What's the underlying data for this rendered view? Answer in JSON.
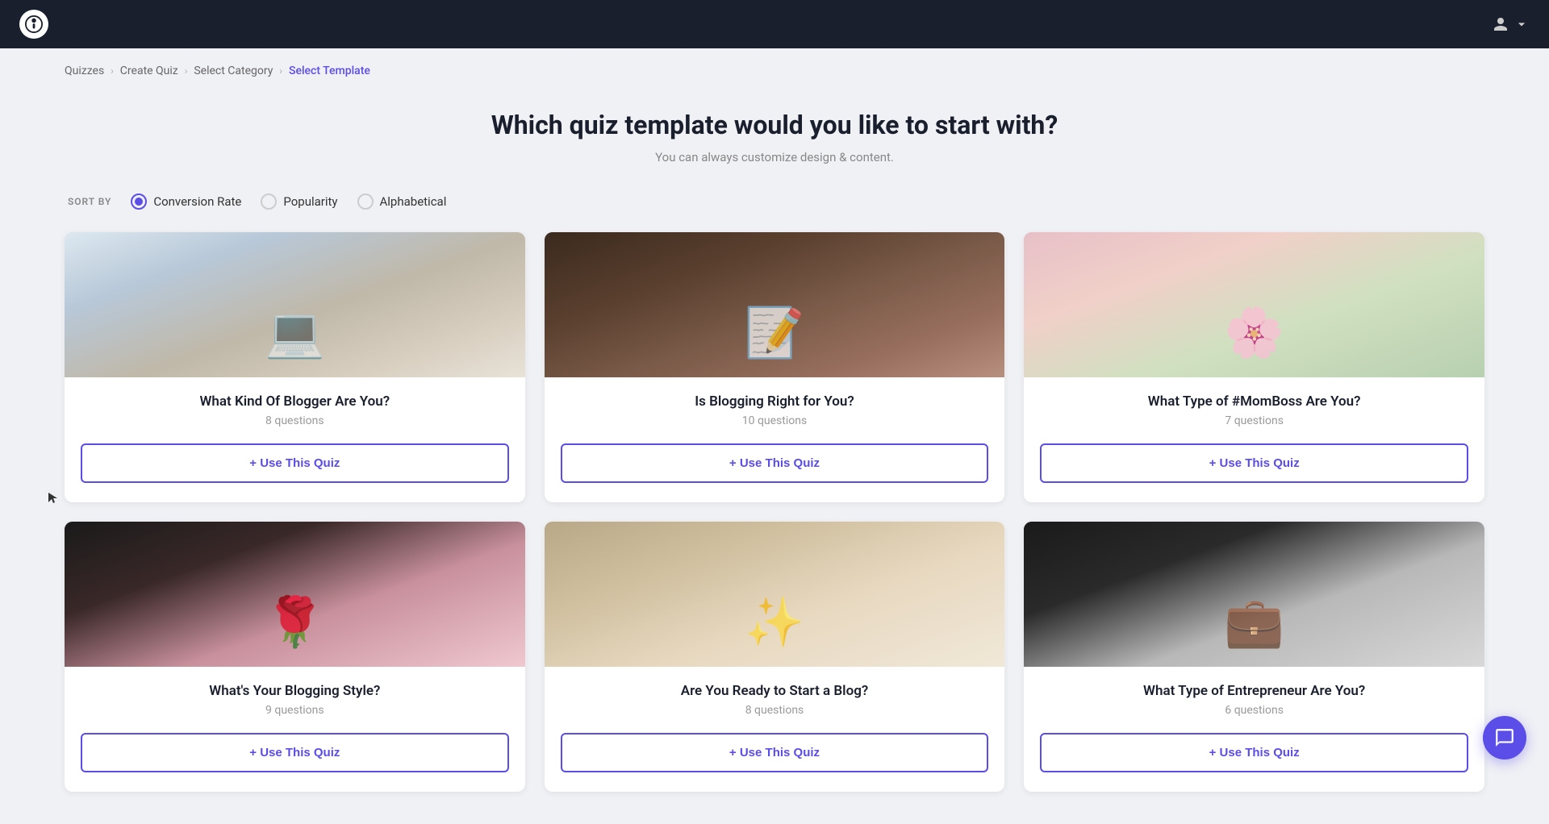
{
  "header": {
    "logo_text": "i",
    "user_icon": "person"
  },
  "breadcrumb": {
    "items": [
      {
        "label": "Quizzes",
        "active": false
      },
      {
        "label": "Create Quiz",
        "active": false
      },
      {
        "label": "Select Category",
        "active": false
      },
      {
        "label": "Select Template",
        "active": true
      }
    ]
  },
  "page": {
    "title": "Which quiz template would you like to start with?",
    "subtitle": "You can always customize design & content."
  },
  "sort_by": {
    "label": "SORT BY",
    "options": [
      {
        "label": "Conversion Rate",
        "selected": true
      },
      {
        "label": "Popularity",
        "selected": false
      },
      {
        "label": "Alphabetical",
        "selected": false
      }
    ]
  },
  "cards": [
    {
      "title": "What Kind Of Blogger Are You?",
      "questions": "8 questions",
      "btn_label": "+ Use This Quiz",
      "img_class": "card-img-1"
    },
    {
      "title": "Is Blogging Right for You?",
      "questions": "10 questions",
      "btn_label": "+ Use This Quiz",
      "img_class": "card-img-2"
    },
    {
      "title": "What Type of #MomBoss Are You?",
      "questions": "7 questions",
      "btn_label": "+ Use This Quiz",
      "img_class": "card-img-3"
    },
    {
      "title": "What's Your Blogging Style?",
      "questions": "9 questions",
      "btn_label": "+ Use This Quiz",
      "img_class": "card-img-4"
    },
    {
      "title": "Are You Ready to Start a Blog?",
      "questions": "8 questions",
      "btn_label": "+ Use This Quiz",
      "img_class": "card-img-5"
    },
    {
      "title": "What Type of Entrepreneur Are You?",
      "questions": "6 questions",
      "btn_label": "+ Use This Quiz",
      "img_class": "card-img-6"
    }
  ]
}
